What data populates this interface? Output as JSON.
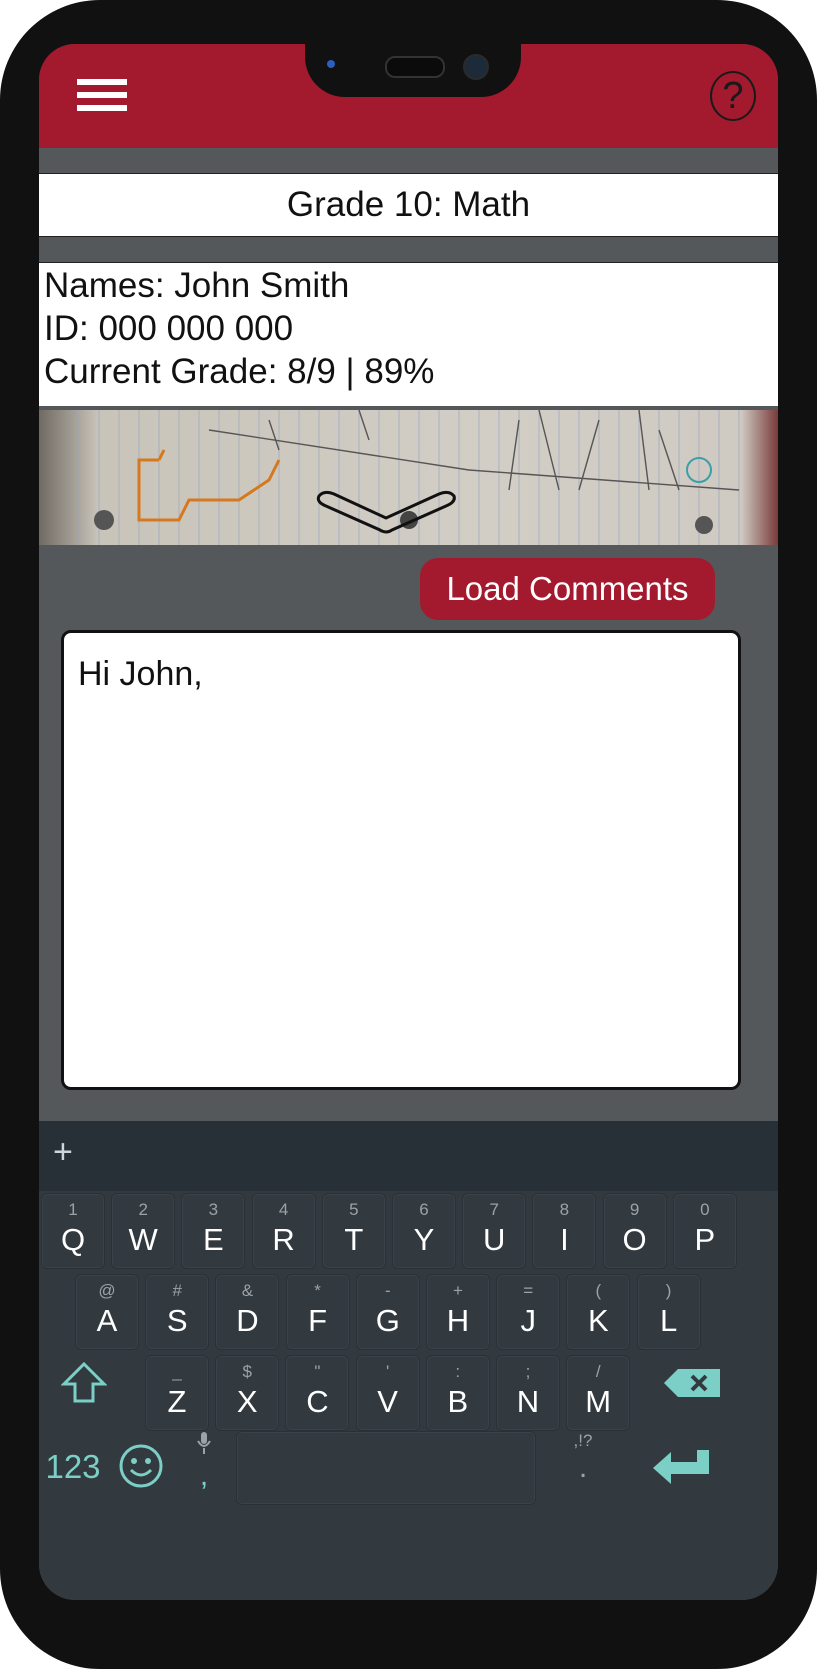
{
  "header": {
    "menu_icon": "hamburger-menu-icon",
    "help_icon": "question-mark-icon",
    "help_glyph": "?",
    "brand_color": "#a3192e"
  },
  "course": {
    "title": "Grade 10: Math"
  },
  "student": {
    "name_line": "Names: John Smith",
    "id_line": "ID: 000 000 000",
    "grade_line": "Current Grade: 8/9 | 89%"
  },
  "photo": {
    "expand_icon": "chevron-down-icon"
  },
  "comments": {
    "load_label": "Load Comments",
    "text": "Hi John,"
  },
  "keyboard": {
    "toolbar_plus": "+",
    "row1": [
      {
        "hint": "1",
        "key": "Q"
      },
      {
        "hint": "2",
        "key": "W"
      },
      {
        "hint": "3",
        "key": "E"
      },
      {
        "hint": "4",
        "key": "R"
      },
      {
        "hint": "5",
        "key": "T"
      },
      {
        "hint": "6",
        "key": "Y"
      },
      {
        "hint": "7",
        "key": "U"
      },
      {
        "hint": "8",
        "key": "I"
      },
      {
        "hint": "9",
        "key": "O"
      },
      {
        "hint": "0",
        "key": "P"
      }
    ],
    "row2": [
      {
        "hint": "@",
        "key": "A"
      },
      {
        "hint": "#",
        "key": "S"
      },
      {
        "hint": "&",
        "key": "D"
      },
      {
        "hint": "*",
        "key": "F"
      },
      {
        "hint": "-",
        "key": "G"
      },
      {
        "hint": "+",
        "key": "H"
      },
      {
        "hint": "=",
        "key": "J"
      },
      {
        "hint": "(",
        "key": "K"
      },
      {
        "hint": ")",
        "key": "L"
      }
    ],
    "row3": [
      {
        "hint": "_",
        "key": "Z"
      },
      {
        "hint": "$",
        "key": "X"
      },
      {
        "hint": "\"",
        "key": "C"
      },
      {
        "hint": "'",
        "key": "V"
      },
      {
        "hint": ":",
        "key": "B"
      },
      {
        "hint": ";",
        "key": "N"
      },
      {
        "hint": "/",
        "key": "M"
      }
    ],
    "numbers_label": "123",
    "comma_label": ",",
    "period_hint": ",!?",
    "period_label": ".",
    "shift_icon": "shift-arrow-icon",
    "backspace_icon": "backspace-icon",
    "emoji_icon": "smiley-face-icon",
    "mic_icon": "microphone-icon",
    "enter_icon": "enter-arrow-icon",
    "accent_color": "#7ccfc6"
  }
}
